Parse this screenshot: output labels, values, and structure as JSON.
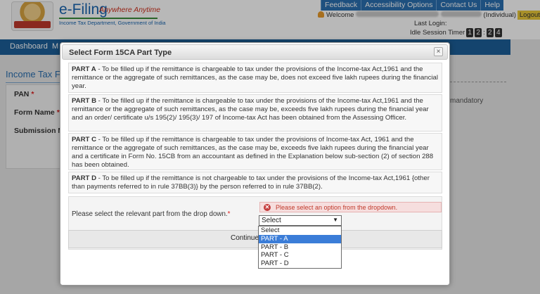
{
  "header": {
    "brand": "e-Filing",
    "tagline": "Anywhere Anytime",
    "subtitle": "Income Tax Department, Government of India",
    "top_nav": [
      "Feedback",
      "Accessibility Options",
      "Contact Us",
      "Help"
    ],
    "welcome_label": "Welcome",
    "individual_label": "(Individual)",
    "logout_label": "Logout",
    "last_login_label": "Last Login:",
    "idle_label": "Idle Session Timer",
    "idle_digits": [
      "1",
      "2",
      "2",
      "4"
    ]
  },
  "nav": {
    "dashboard_label": "Dashboard",
    "truncated_label": "M"
  },
  "background_form": {
    "section_title": "Income Tax Fo",
    "pan_label": "PAN",
    "form_name_label": "Form Name",
    "submission_label": "Submission M",
    "required_mark": "*",
    "mandatory_text": "mandatory"
  },
  "dialog": {
    "title": "Select Form 15CA Part Type",
    "close_symbol": "×",
    "parts": [
      {
        "label": "PART A",
        "text": " - To be filled up if the remittance is chargeable to tax under the provisions of the Income-tax Act,1961 and the remittance or the aggregate of such remittances, as the case may be, does not exceed five lakh rupees during the financial year."
      },
      {
        "label": "PART B",
        "text": " - To be filled up if the remittance is chargeable to tax under the provisions of the Income-tax Act,1961 and the remittance or the aggregate of such remittances, as the case may be, exceeds five lakh rupees during the financial year and an order/ certificate u/s 195(2)/ 195(3)/ 197 of Income-tax Act has been obtained from the Assessing Officer."
      },
      {
        "label": "PART C",
        "text": " - To be filled up if the remittance is chargeable to tax under the provisions of Income-tax Act, 1961 and the remittance or the aggregate of such remittances, as the case may be, exceeds five lakh rupees during the financial year and a certificate in Form No. 15CB from an accountant as defined in the Explanation below sub-section (2) of section 288 has been obtained."
      },
      {
        "label": "PART D",
        "text": " - To be filled up if the remittance is not chargeable to tax under the provisions of the Income-tax Act,1961 {other than payments referred to in rule 37BB(3)} by the person referred to in rule 37BB(2)."
      }
    ],
    "select_label": "Please select the relevant part from the drop down.",
    "required_mark": "*",
    "error_message": "Please select an option from the dropdown.",
    "select_value": "Select",
    "options": [
      "Select",
      "PART - A",
      "PART - B",
      "PART - C",
      "PART - D"
    ],
    "highlighted_option": "PART - A",
    "continue_label": "Continue"
  }
}
